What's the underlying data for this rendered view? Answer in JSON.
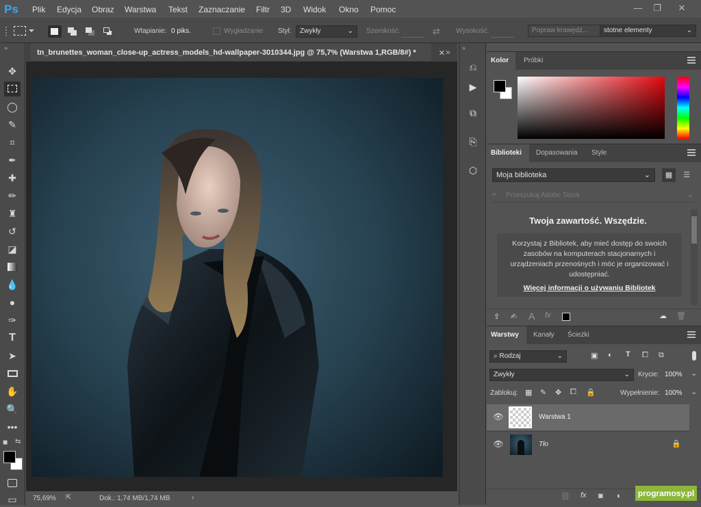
{
  "app": {
    "logo": "Ps"
  },
  "menu": [
    "Plik",
    "Edycja",
    "Obraz",
    "Warstwa",
    "Tekst",
    "Zaznaczanie",
    "Filtr",
    "3D",
    "Widok",
    "Okno",
    "Pomoc"
  ],
  "window_controls": {
    "minimize": "—",
    "restore": "❐",
    "close": "✕"
  },
  "options": {
    "feather_label": "Wtapianie:",
    "feather_value": "0 piks.",
    "antialias_label": "Wygładzanie",
    "style_label": "Styl:",
    "style_value": "Zwykły",
    "width_label": "Szerokość:",
    "height_label": "Wysokość:",
    "refine_label": "Popraw krawędź...",
    "workspace_value": "stotne elementy"
  },
  "document": {
    "tab_title": "tn_brunettes_woman_close-up_actress_models_hd-wallpaper-3010344.jpg @ 75,7% (Warstwa 1,RGB/8#) *",
    "zoom": "75,69%",
    "doc_info": "Dok.: 1,74 MB/1,74 MB"
  },
  "tools": [
    "move-icon",
    "marquee-icon",
    "lasso-icon",
    "quick-select-icon",
    "crop-icon",
    "eyedropper-icon",
    "healing-icon",
    "brush-icon",
    "stamp-icon",
    "history-brush-icon",
    "eraser-icon",
    "gradient-icon",
    "blur-icon",
    "dodge-icon",
    "pen-icon",
    "type-icon",
    "path-select-icon",
    "rectangle-icon",
    "hand-icon",
    "zoom-icon",
    "more-icon"
  ],
  "color_panel": {
    "tabs": [
      "Kolor",
      "Próbki"
    ]
  },
  "libraries_panel": {
    "tabs": [
      "Biblioteki",
      "Dopasowania",
      "Style"
    ],
    "library_select": "Moja biblioteka",
    "search_placeholder": "Przeszukaj Adobe Stock",
    "heading": "Twoja zawartość. Wszędzie.",
    "body": "Korzystaj z Bibliotek, aby mieć dostęp do swoich zasobów na komputerach stacjonarnych i urządzeniach przenośnych i móc je organizować i udostępniać.",
    "link": "Więcej informacji o używaniu Bibliotek"
  },
  "layers_panel": {
    "tabs": [
      "Warstwy",
      "Kanały",
      "Ścieżki"
    ],
    "filter": "Rodzaj",
    "blend_mode": "Zwykły",
    "opacity_label": "Krycie:",
    "opacity_value": "100%",
    "lock_label": "Zablokuj:",
    "fill_label": "Wypełnienie:",
    "fill_value": "100%",
    "layers": [
      {
        "name": "Warstwa 1"
      },
      {
        "name": "Tło"
      }
    ]
  },
  "watermark": "programosy.pl",
  "colors": {
    "accent": "#31a8ff",
    "watermark_green": "#8db63a",
    "selected_layer": "#6a6a6a"
  }
}
